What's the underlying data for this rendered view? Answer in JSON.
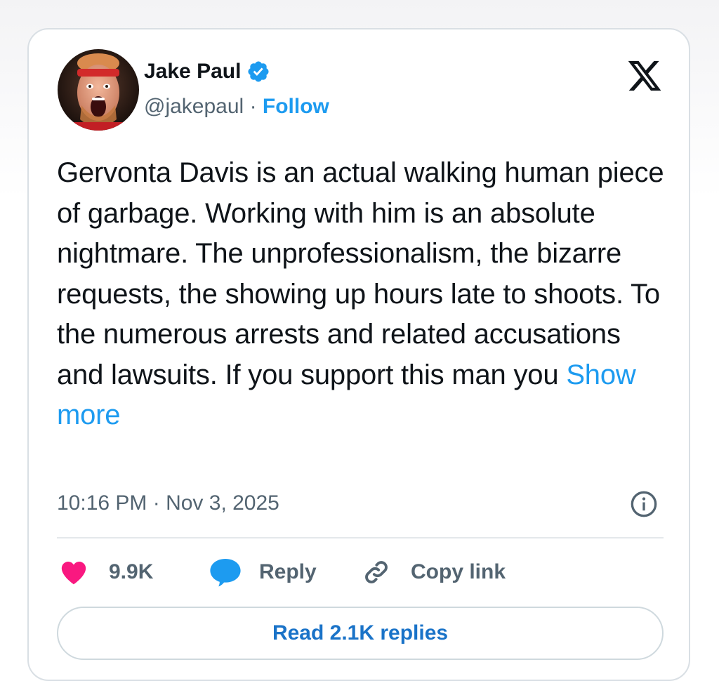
{
  "author": {
    "name": "Jake Paul",
    "handle": "@jakepaul",
    "separator": "·",
    "follow_label": "Follow",
    "avatar_icon": "profile-photo-screaming-man-headband",
    "verified_icon": "verified-badge-icon"
  },
  "brand": {
    "logo_icon": "x-logo-icon"
  },
  "tweet": {
    "text": "Gervonta Davis is an actual walking human piece of garbage. Working with him is an absolute nightmare. The unprofessionalism, the bizarre requests, the showing up hours late to shoots. To the numerous arrests and related accusations and lawsuits. If you support this man you",
    "show_more_label": "Show more",
    "timestamp": "10:16 PM · Nov 3, 2025"
  },
  "actions": {
    "like_count": "9.9K",
    "reply_label": "Reply",
    "copy_link_label": "Copy link"
  },
  "footer": {
    "read_replies_label": "Read 2.1K replies"
  },
  "colors": {
    "accent": "#1d9bf0",
    "text": "#0f1419",
    "muted": "#536471",
    "like": "#f91880",
    "border": "#d9dfe4"
  }
}
